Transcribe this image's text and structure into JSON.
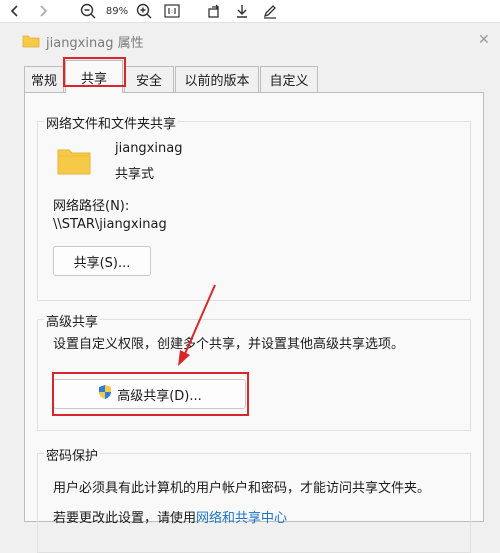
{
  "viewer": {
    "zoom": "89%",
    "icons": [
      "chevron-left-icon",
      "chevron-right-icon",
      "zoom-out-icon",
      "zoom-in-icon",
      "actual-size-icon",
      "rotate-icon",
      "download-icon",
      "edit-icon"
    ]
  },
  "window": {
    "title": "jiangxinag 属性"
  },
  "tabs": [
    "常规",
    "共享",
    "安全",
    "以前的版本",
    "自定义"
  ],
  "active_tab": "共享",
  "share_group": {
    "title": "网络文件和文件夹共享",
    "folder_name": "jiangxinag",
    "state": "共享式",
    "network_path_label": "网络路径(N):",
    "network_path": "\\\\STAR\\jiangxinag",
    "share_button": "共享(S)..."
  },
  "advanced_group": {
    "title": "高级共享",
    "description": "设置自定义权限，创建多个共享，并设置其他高级共享选项。",
    "button": "高级共享(D)..."
  },
  "password_group": {
    "title": "密码保护",
    "line1": "用户必须具有此计算机的用户帐户和密码，才能访问共享文件夹。",
    "line2_prefix": "若要更改此设置，请使用",
    "line2_link": "网络和共享中心"
  },
  "colors": {
    "highlight": "#d9262a",
    "folder": "#f7c948",
    "link": "#1a73c9"
  }
}
